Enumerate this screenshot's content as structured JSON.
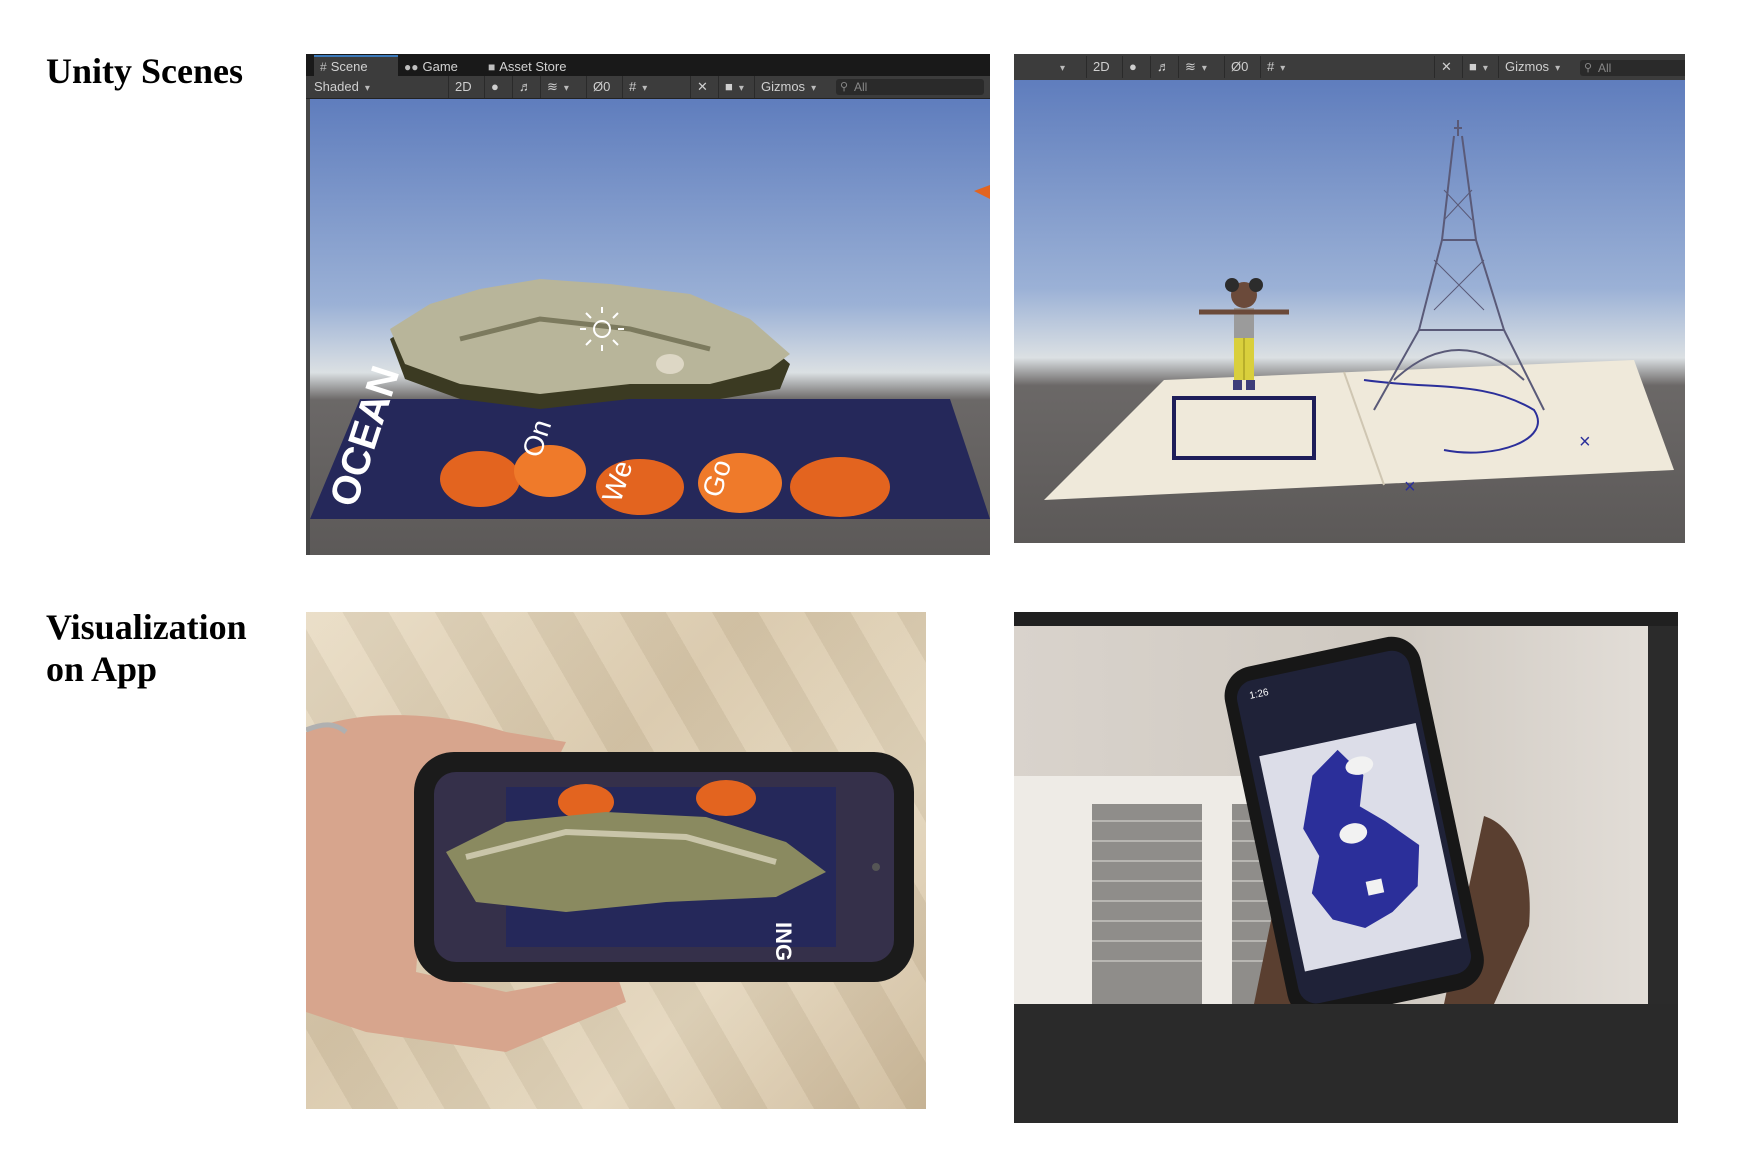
{
  "rows": {
    "unity_scenes_label": "Unity Scenes",
    "app_label_line1": "Visualization",
    "app_label_line2": "on App"
  },
  "left_editor": {
    "tabs": [
      {
        "label": "Scene",
        "icon": "grid-icon"
      },
      {
        "label": "Game",
        "icon": "gamepad-icon"
      },
      {
        "label": "Asset Store",
        "icon": "bag-icon"
      }
    ],
    "shading_mode": "Shaded",
    "mode_2d": "2D",
    "hidden_count": "0",
    "gizmos_label": "Gizmos",
    "search_placeholder": "All",
    "book_text": "OCEAN",
    "book_letters": [
      "On",
      "We",
      "Go"
    ]
  },
  "right_editor": {
    "mode_2d": "2D",
    "hidden_count": "0",
    "gizmos_label": "Gizmos",
    "search_placeholder": "All",
    "card_mark": "×"
  },
  "phone_left": {
    "book_text": "ING"
  },
  "phone_right": {
    "status_time": "1:26"
  },
  "colors": {
    "unity_bg": "#474747",
    "toolbar": "#3c3c3c",
    "tab_strip": "#191919",
    "europe_blue": "#2b2f9a",
    "leaf_orange": "#e3641f",
    "book_navy": "#25285a"
  }
}
